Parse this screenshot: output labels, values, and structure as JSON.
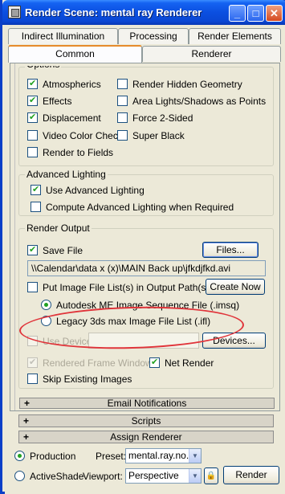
{
  "window": {
    "title": "Render Scene: mental ray Renderer",
    "minimize": "_",
    "maximize": "□",
    "close": "✕"
  },
  "tabs": {
    "row1": [
      "Indirect Illumination",
      "Processing",
      "Render Elements"
    ],
    "row2": [
      "Common",
      "Renderer"
    ],
    "active": "Common"
  },
  "options": {
    "title": "Options",
    "items": [
      {
        "label": "Atmospherics",
        "checked": true
      },
      {
        "label": "Effects",
        "checked": true
      },
      {
        "label": "Displacement",
        "checked": true
      },
      {
        "label": "Video Color Check",
        "checked": false
      },
      {
        "label": "Render to Fields",
        "checked": false
      },
      {
        "label": "Render Hidden Geometry",
        "checked": false
      },
      {
        "label": "Area Lights/Shadows as Points",
        "checked": false
      },
      {
        "label": "Force 2-Sided",
        "checked": false
      },
      {
        "label": "Super Black",
        "checked": false
      }
    ]
  },
  "advanced_lighting": {
    "title": "Advanced Lighting",
    "use_label": "Use Advanced Lighting",
    "use_checked": true,
    "compute_label": "Compute Advanced Lighting when Required",
    "compute_checked": false
  },
  "render_output": {
    "title": "Render Output",
    "save_file_label": "Save File",
    "save_file_checked": true,
    "files_button": "Files...",
    "file_path": "\\\\Calendar\\data x (x)\\MAIN Back up\\jfkdjfkd.avi",
    "put_image_label": "Put Image File List(s) in Output Path(s)",
    "put_image_checked": false,
    "create_now_button": "Create Now",
    "radio_autodesk": "Autodesk ME Image Sequence File (.imsq)",
    "radio_legacy": "Legacy 3ds max Image File List (.ifl)",
    "use_device_label": "Use Device",
    "devices_button": "Devices...",
    "rendered_frame_label": "Rendered Frame Window",
    "rendered_frame_checked": true,
    "net_render_label": "Net Render",
    "net_render_checked": true,
    "skip_existing_label": "Skip Existing Images",
    "skip_existing_checked": false
  },
  "rollouts": [
    "Email Notifications",
    "Scripts",
    "Assign Renderer"
  ],
  "rollout_plus": "+",
  "footer": {
    "production_label": "Production",
    "activeshade_label": "ActiveShade",
    "preset_label": "Preset:",
    "preset_value": "mental.ray.no.gi",
    "viewport_label": "Viewport:",
    "viewport_value": "Perspective",
    "render_button": "Render",
    "lock_icon": "🔒"
  },
  "colors": {
    "title_bar": "#0b4fe0",
    "highlight_ellipse": "#e0343a",
    "check_green": "#21a121"
  }
}
